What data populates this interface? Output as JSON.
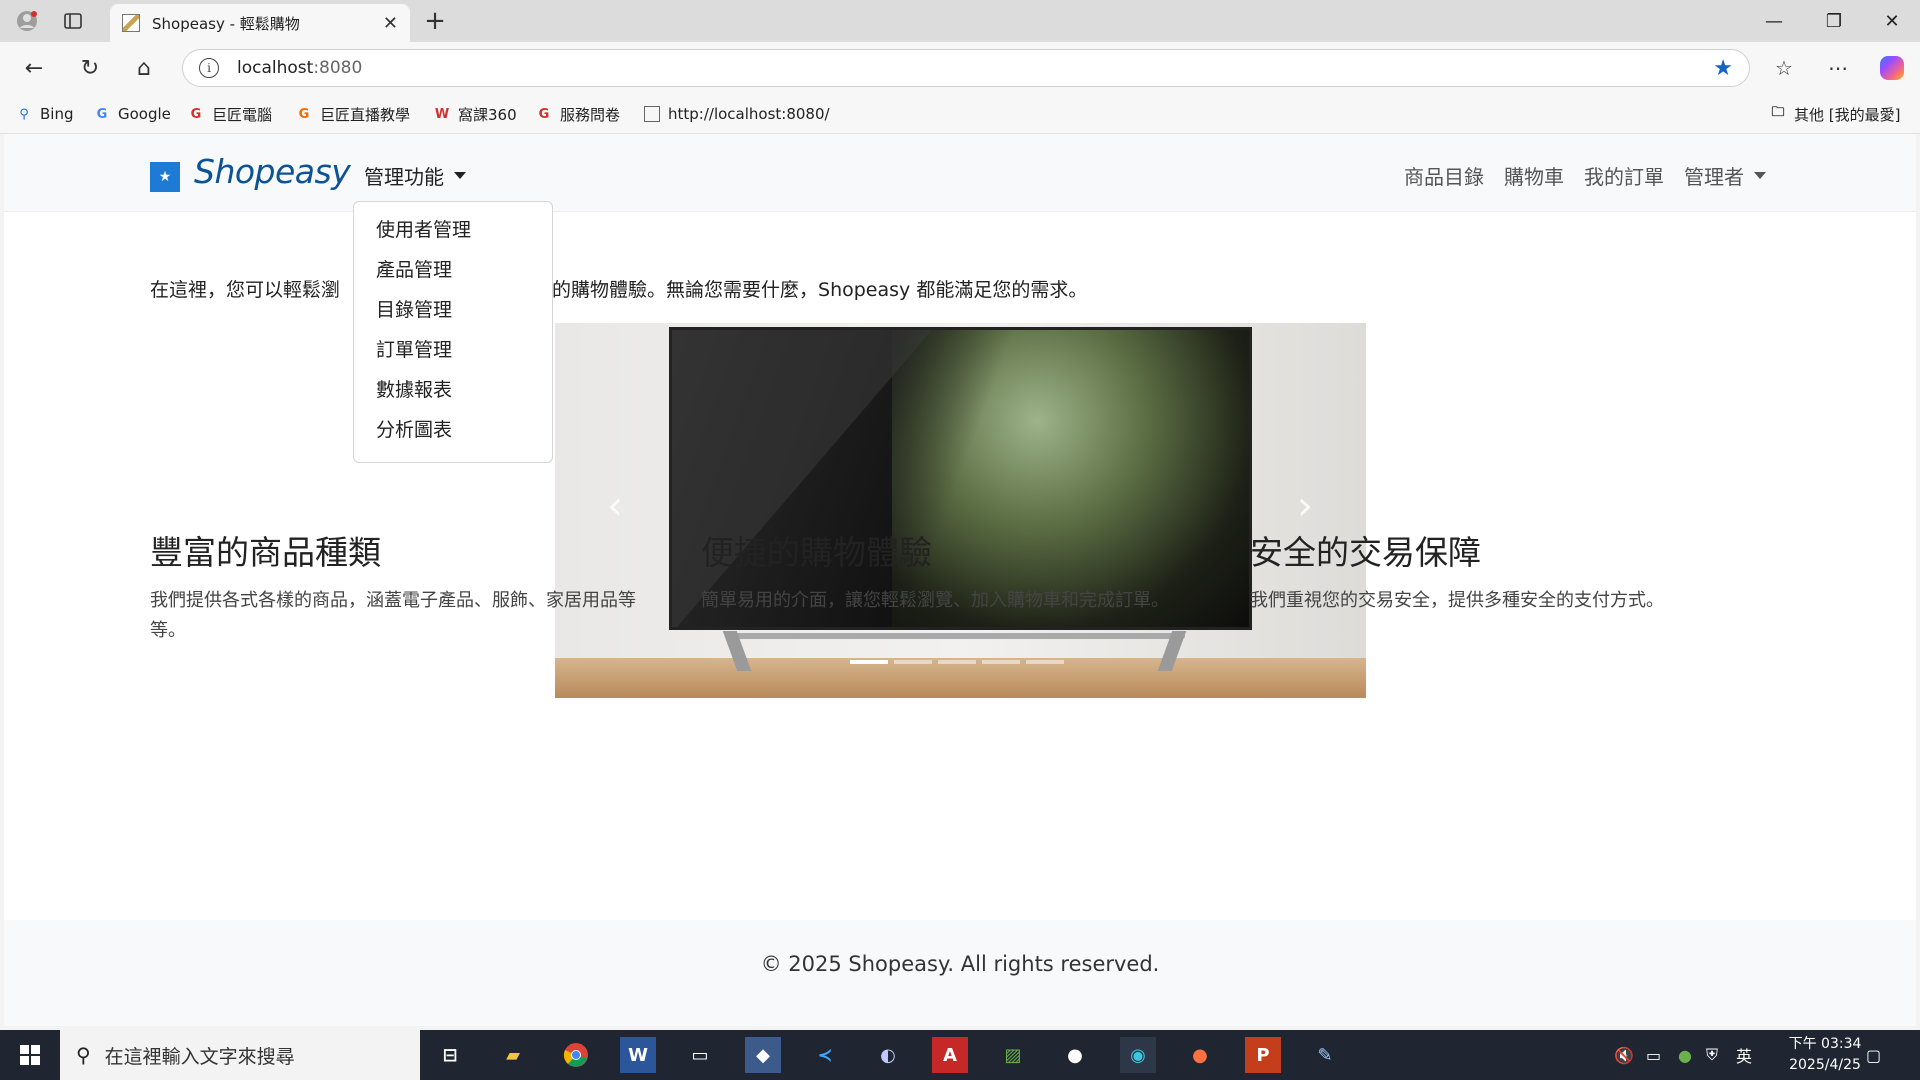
{
  "browser": {
    "tab_title": "Shopeasy - 輕鬆購物",
    "url_host": "localhost",
    "url_port": ":8080",
    "bookmarks": [
      {
        "label": "Bing",
        "icon": "bing-icon"
      },
      {
        "label": "Google",
        "icon": "google-icon"
      },
      {
        "label": "巨匠電腦",
        "icon": "gjun-icon"
      },
      {
        "label": "巨匠直播教學",
        "icon": "gjun-live-icon"
      },
      {
        "label": "窩課360",
        "icon": "wocourse-icon"
      },
      {
        "label": "服務問卷",
        "icon": "survey-icon"
      },
      {
        "label": "http://localhost:8080/",
        "icon": "page-icon"
      }
    ],
    "other_favorites": "其他 [我的最愛]"
  },
  "navbar": {
    "brand": "Shopeasy",
    "admin_menu": "管理功能",
    "links": [
      "商品目錄",
      "購物車",
      "我的訂單"
    ],
    "user_menu": "管理者"
  },
  "dropdown": {
    "items": [
      "使用者管理",
      "產品管理",
      "目錄管理",
      "訂單管理",
      "數據報表",
      "分析圖表"
    ]
  },
  "main": {
    "intro_left": "在這裡，您可以輕鬆瀏",
    "intro_right": "的購物體驗。無論您需要什麼，Shopeasy 都能滿足您的需求。",
    "carousel": {
      "slides": 5,
      "active": 0
    },
    "features": [
      {
        "title": "豐富的商品種類",
        "desc": "我們提供各式各樣的商品，涵蓋電子產品、服飾、家居用品等等。"
      },
      {
        "title": "便捷的購物體驗",
        "desc": "簡單易用的介面，讓您輕鬆瀏覽、加入購物車和完成訂單。"
      },
      {
        "title": "安全的交易保障",
        "desc": "我們重視您的交易安全，提供多種安全的支付方式。"
      }
    ]
  },
  "footer": {
    "text": "© 2025 Shopeasy. All rights reserved."
  },
  "taskbar": {
    "search_placeholder": "在這裡輸入文字來搜尋",
    "ime": "英",
    "time": "下午 03:34",
    "date": "2025/4/25"
  },
  "colors": {
    "brand": "#0b5394",
    "logo": "#1f7ad6",
    "star": "#1565c0",
    "taskbar": "#1f2632"
  }
}
